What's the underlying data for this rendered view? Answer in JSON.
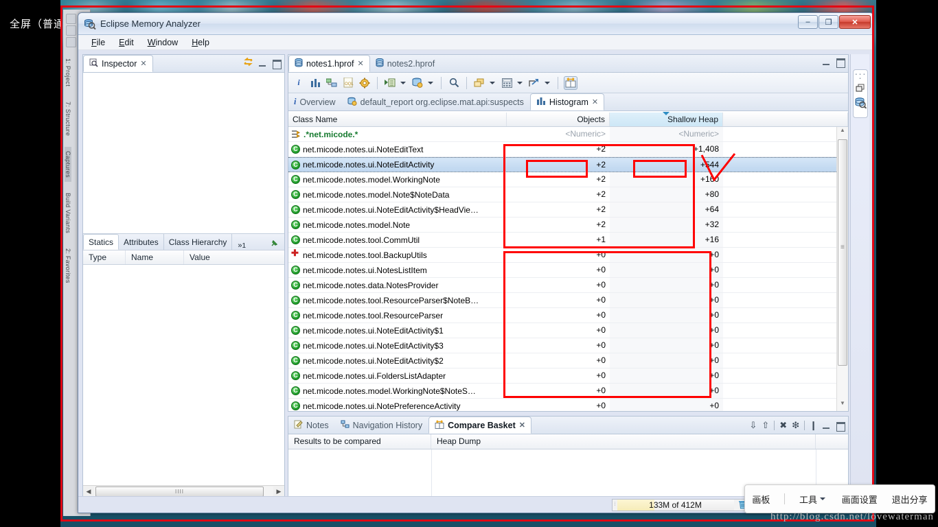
{
  "share_label": "全屏（普通）",
  "window": {
    "title": "Eclipse Memory Analyzer",
    "icon": "memory-analyzer-icon",
    "minimize": "–",
    "maximize": "❐",
    "close": "✕"
  },
  "menubar": [
    {
      "label": "File",
      "mnemonic": "F"
    },
    {
      "label": "Edit",
      "mnemonic": "E"
    },
    {
      "label": "Window",
      "mnemonic": "W"
    },
    {
      "label": "Help",
      "mnemonic": "H"
    }
  ],
  "inspector": {
    "tab_label": "Inspector",
    "tab_icon": "inspector-icon",
    "close_glyph": "✕",
    "link_icon": "link-with-editor-icon",
    "subtabs": [
      {
        "label": "Statics",
        "selected": true
      },
      {
        "label": "Attributes",
        "selected": false
      },
      {
        "label": "Class Hierarchy",
        "selected": false
      }
    ],
    "more_tabs": "»",
    "more_tabs_count": "1",
    "pin_icon": "pin-icon",
    "columns": [
      "Type",
      "Name",
      "Value"
    ],
    "scroll_thumb_grip": "IIII",
    "scroll_left": "◀",
    "scroll_right": "▶"
  },
  "editor": {
    "tabs": [
      {
        "label": "notes1.hprof",
        "selected": true,
        "close_glyph": "✕",
        "icon": "heap-dump-icon"
      },
      {
        "label": "notes2.hprof",
        "selected": false,
        "icon": "heap-dump-icon"
      }
    ],
    "toolbar": [
      {
        "name": "info-icon",
        "glyph": "i"
      },
      {
        "name": "histogram-icon",
        "glyph": "▮▮▮"
      },
      {
        "name": "dominator-tree-icon",
        "glyph": "▤"
      },
      {
        "name": "oql-icon",
        "glyph": "OQL"
      },
      {
        "name": "run-expert-system-icon",
        "glyph": "⚙"
      },
      {
        "name": "open-query-browser-icon",
        "glyph": "▶",
        "has_dropdown": true
      },
      {
        "name": "heap-dump-query-icon",
        "glyph": "☰",
        "has_dropdown": true
      },
      {
        "name": "search-icon",
        "glyph": "🔍"
      },
      {
        "name": "group-by-icon",
        "glyph": "❏",
        "has_dropdown": true
      },
      {
        "name": "calculator-icon",
        "glyph": "▦",
        "has_dropdown": true
      },
      {
        "name": "export-icon",
        "glyph": "↗",
        "has_dropdown": true
      },
      {
        "name": "compare-icon",
        "glyph": "⇔",
        "toggled": true
      }
    ],
    "inner_tabs": [
      {
        "label": "Overview",
        "selected": false,
        "icon": "info-icon"
      },
      {
        "label": "default_report  org.eclipse.mat.api:suspects",
        "selected": false,
        "icon": "report-icon"
      },
      {
        "label": "Histogram",
        "selected": true,
        "icon": "histogram-icon",
        "close_glyph": "✕"
      }
    ]
  },
  "histogram": {
    "columns": [
      "Class Name",
      "Objects",
      "Shallow Heap",
      ""
    ],
    "sorted_column": "Shallow Heap",
    "sort_direction": "descending",
    "filter_row": {
      "class_name": ".*net.micode.*",
      "objects": "<Numeric>",
      "shallow_heap": "<Numeric>"
    },
    "rows": [
      {
        "class_name": "net.micode.notes.ui.NoteEditText",
        "objects": "+2",
        "shallow_heap": "+1,408",
        "icon": "class-icon",
        "selected": false
      },
      {
        "class_name": "net.micode.notes.ui.NoteEditActivity",
        "objects": "+2",
        "shallow_heap": "+544",
        "icon": "class-icon",
        "selected": true
      },
      {
        "class_name": "net.micode.notes.model.WorkingNote",
        "objects": "+2",
        "shallow_heap": "+160",
        "icon": "class-icon",
        "selected": false
      },
      {
        "class_name": "net.micode.notes.model.Note$NoteData",
        "objects": "+2",
        "shallow_heap": "+80",
        "icon": "class-icon",
        "selected": false
      },
      {
        "class_name": "net.micode.notes.ui.NoteEditActivity$HeadVie…",
        "objects": "+2",
        "shallow_heap": "+64",
        "icon": "class-icon",
        "selected": false
      },
      {
        "class_name": "net.micode.notes.model.Note",
        "objects": "+2",
        "shallow_heap": "+32",
        "icon": "class-icon",
        "selected": false
      },
      {
        "class_name": "net.micode.notes.tool.CommUtil",
        "objects": "+1",
        "shallow_heap": "+16",
        "icon": "class-icon",
        "selected": false
      },
      {
        "class_name": "net.micode.notes.tool.BackupUtils",
        "objects": "+0",
        "shallow_heap": "+0",
        "icon": "class-added-icon",
        "selected": false
      },
      {
        "class_name": "net.micode.notes.ui.NotesListItem",
        "objects": "+0",
        "shallow_heap": "+0",
        "icon": "class-icon",
        "selected": false
      },
      {
        "class_name": "net.micode.notes.data.NotesProvider",
        "objects": "+0",
        "shallow_heap": "+0",
        "icon": "class-icon",
        "selected": false
      },
      {
        "class_name": "net.micode.notes.tool.ResourceParser$NoteB…",
        "objects": "+0",
        "shallow_heap": "+0",
        "icon": "class-icon",
        "selected": false
      },
      {
        "class_name": "net.micode.notes.tool.ResourceParser",
        "objects": "+0",
        "shallow_heap": "+0",
        "icon": "class-icon",
        "selected": false
      },
      {
        "class_name": "net.micode.notes.ui.NoteEditActivity$1",
        "objects": "+0",
        "shallow_heap": "+0",
        "icon": "class-icon",
        "selected": false
      },
      {
        "class_name": "net.micode.notes.ui.NoteEditActivity$3",
        "objects": "+0",
        "shallow_heap": "+0",
        "icon": "class-icon",
        "selected": false
      },
      {
        "class_name": "net.micode.notes.ui.NoteEditActivity$2",
        "objects": "+0",
        "shallow_heap": "+0",
        "icon": "class-icon",
        "selected": false
      },
      {
        "class_name": "net.micode.notes.ui.FoldersListAdapter",
        "objects": "+0",
        "shallow_heap": "+0",
        "icon": "class-icon",
        "selected": false
      },
      {
        "class_name": "net.micode.notes.model.WorkingNote$NoteS…",
        "objects": "+0",
        "shallow_heap": "+0",
        "icon": "class-icon",
        "selected": false
      },
      {
        "class_name": "net.micode.notes.ui.NotePreferenceActivity",
        "objects": "+0",
        "shallow_heap": "+0",
        "icon": "class-icon",
        "selected": false
      }
    ]
  },
  "bottom_panel": {
    "tabs": [
      {
        "label": "Notes",
        "selected": false,
        "icon": "notes-icon"
      },
      {
        "label": "Navigation History",
        "selected": false,
        "icon": "navigation-history-icon"
      },
      {
        "label": "Compare Basket",
        "selected": true,
        "icon": "compare-basket-icon",
        "close_glyph": "✕"
      }
    ],
    "toolbar": [
      {
        "name": "move-down-icon",
        "glyph": "⇩"
      },
      {
        "name": "move-up-icon",
        "glyph": "⇧"
      },
      {
        "name": "remove-icon",
        "glyph": "✖"
      },
      {
        "name": "remove-all-icon",
        "glyph": "❇"
      },
      {
        "name": "compare-now-icon",
        "glyph": "❙"
      }
    ],
    "columns": [
      "Results to be compared",
      "Heap Dump",
      ""
    ],
    "rows": []
  },
  "perspective_bar": {
    "restore_icon": "restore-perspective-icon",
    "open_perspective_icon": "memory-analysis-perspective-icon",
    "dots": "▪ ▪ ▪ ▪"
  },
  "statusbar": {
    "heap_text": "133M of 412M",
    "heap_used_percent": 32,
    "trash_icon": "trash-icon"
  },
  "share_toolbar": {
    "items": [
      {
        "label": "画板",
        "has_dropdown": false
      },
      {
        "label": "工具",
        "has_dropdown": true
      },
      {
        "label": "画面设置",
        "has_dropdown": false
      },
      {
        "label": "退出分享",
        "has_dropdown": false
      }
    ]
  },
  "watermark": "http://blog.csdn.net/lovewaterman",
  "background_ide": {
    "side_tabs": [
      "1: Project",
      "7: Structure",
      "Captures",
      "Build Variants",
      "2: Favorites"
    ]
  },
  "annotations": {
    "color": "#ff0000",
    "shapes": [
      "box-top-group",
      "box-objects-cell",
      "box-shallow-cell",
      "box-bottom-group",
      "checkmark"
    ]
  }
}
